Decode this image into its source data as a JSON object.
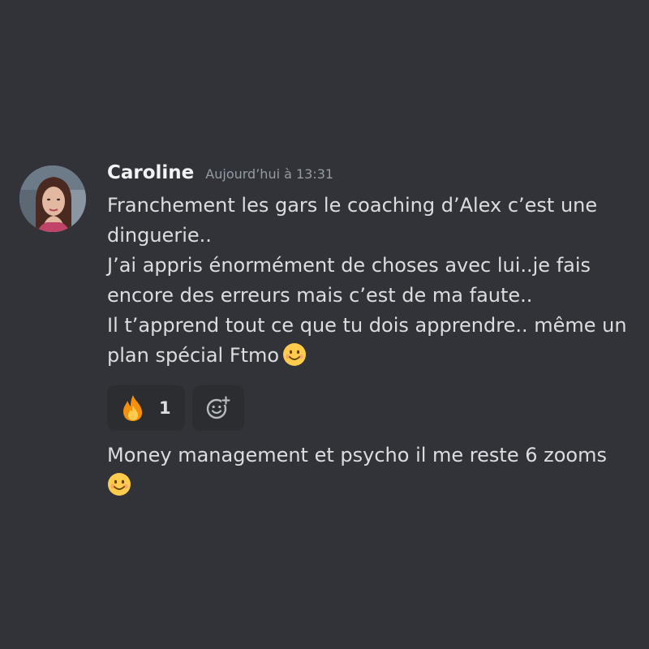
{
  "message": {
    "author": "Caroline",
    "timestamp": "Aujourd’hui à 13:31",
    "lines": [
      "Franchement les gars le coaching d’Alex c’est une",
      "dinguerie..",
      "J’ai appris énormément de choses avec lui..je fais",
      "encore des erreurs mais c’est de ma faute..",
      "Il t’apprend tout ce que tu dois apprendre.. même un",
      "plan spécial Ftmo"
    ],
    "trailing_emoji": "smiling-face-emoji"
  },
  "reactions": [
    {
      "emoji": "fire-emoji",
      "count": "1"
    }
  ],
  "add_reaction_icon": "add-reaction-icon",
  "followup": {
    "text": "Money management et psycho il me reste 6 zooms",
    "trailing_emoji": "smiling-face-emoji"
  },
  "colors": {
    "background": "#313338",
    "username": "#f2f3f5",
    "timestamp": "#949ba4",
    "text": "#dbdee1",
    "reaction_bg": "#2b2d31"
  }
}
